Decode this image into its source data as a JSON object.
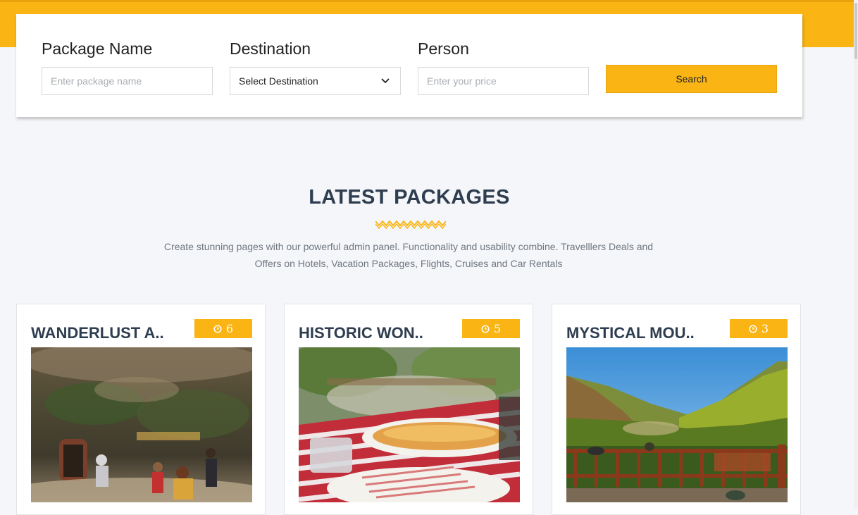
{
  "search": {
    "package_name_label": "Package Name",
    "package_name_placeholder": "Enter package name",
    "destination_label": "Destination",
    "destination_value": "Select Destination",
    "person_label": "Person",
    "person_placeholder": "Enter your price",
    "search_button": "Search"
  },
  "section": {
    "title": "LATEST PACKAGES",
    "description_line1": "Create stunning pages with our powerful admin panel. Functionality and usability combine. Travelllers Deals and",
    "description_line2": "Offers on Hotels, Vacation Packages, Flights, Cruises and Car Rentals"
  },
  "packages": [
    {
      "title": "WANDERLUST A..",
      "days": "6",
      "icon": "clock-icon"
    },
    {
      "title": "HISTORIC WON..",
      "days": "5",
      "icon": "clock-icon"
    },
    {
      "title": "MYSTICAL MOU..",
      "days": "3",
      "icon": "clock-icon"
    }
  ],
  "colors": {
    "accent": "#fab514",
    "heading": "#2e3d4f",
    "background": "#f5f6f9"
  }
}
